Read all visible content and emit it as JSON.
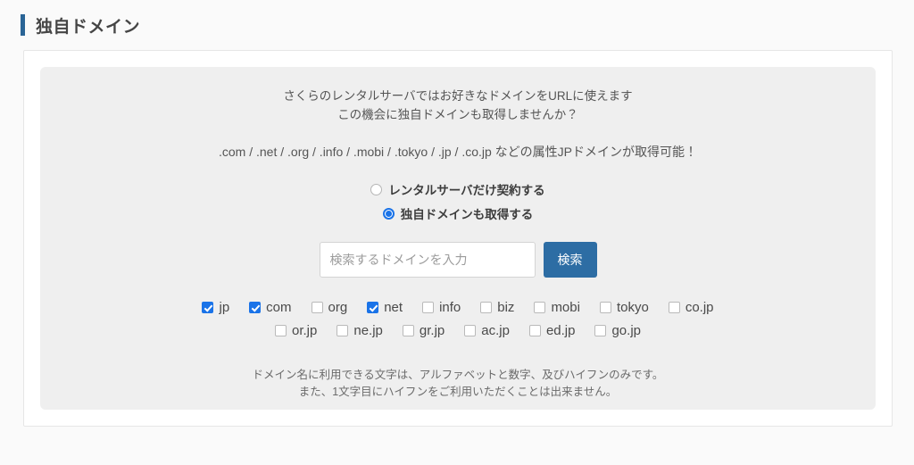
{
  "page": {
    "title": "独自ドメイン"
  },
  "panel": {
    "lead_line1": "さくらのレンタルサーバではお好きなドメインをURLに使えます",
    "lead_line2": "この機会に独自ドメインも取得しませんか？",
    "tld_line": ".com / .net / .org / .info / .mobi / .tokyo / .jp / .co.jp などの属性JPドメインが取得可能！",
    "note_line1": "ドメイン名に利用できる文字は、アルファベットと数字、及びハイフンのみです。",
    "note_line2": "また、1文字目にハイフンをご利用いただくことは出来ません。"
  },
  "radios": [
    {
      "label": "レンタルサーバだけ契約する",
      "checked": false
    },
    {
      "label": "独自ドメインも取得する",
      "checked": true
    }
  ],
  "search": {
    "value": "",
    "placeholder": "検索するドメインを入力",
    "button_label": "検索"
  },
  "checkbox_rows": [
    [
      {
        "label": "jp",
        "checked": true
      },
      {
        "label": "com",
        "checked": true
      },
      {
        "label": "org",
        "checked": false
      },
      {
        "label": "net",
        "checked": true
      },
      {
        "label": "info",
        "checked": false
      },
      {
        "label": "biz",
        "checked": false
      },
      {
        "label": "mobi",
        "checked": false
      },
      {
        "label": "tokyo",
        "checked": false
      },
      {
        "label": "co.jp",
        "checked": false
      }
    ],
    [
      {
        "label": "or.jp",
        "checked": false
      },
      {
        "label": "ne.jp",
        "checked": false
      },
      {
        "label": "gr.jp",
        "checked": false
      },
      {
        "label": "ac.jp",
        "checked": false
      },
      {
        "label": "ed.jp",
        "checked": false
      },
      {
        "label": "go.jp",
        "checked": false
      }
    ]
  ],
  "colors": {
    "accent": "#2a6496",
    "button": "#2d6da4",
    "control_blue": "#1a73e8",
    "panel_bg": "#efefef",
    "page_bg": "#fafafa"
  }
}
